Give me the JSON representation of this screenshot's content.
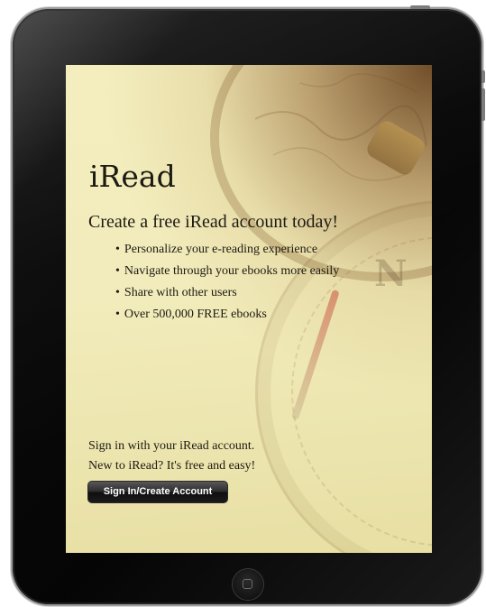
{
  "app": {
    "title": "iRead",
    "headline": "Create a free iRead account today!",
    "features": [
      "Personalize your e-reading experience",
      "Navigate through your ebooks more easily",
      "Share with other users",
      "Over 500,000 FREE ebooks"
    ]
  },
  "signin": {
    "line1": "Sign in with your iRead account.",
    "line2": "New to iRead? It's free and easy!",
    "button_label": "Sign In/Create Account"
  },
  "background": {
    "compass_letter": "N",
    "theme": "vintage map and compass"
  },
  "colors": {
    "text": "#1d1a12",
    "button": "#1b1b1b",
    "bezel": "#050505"
  }
}
